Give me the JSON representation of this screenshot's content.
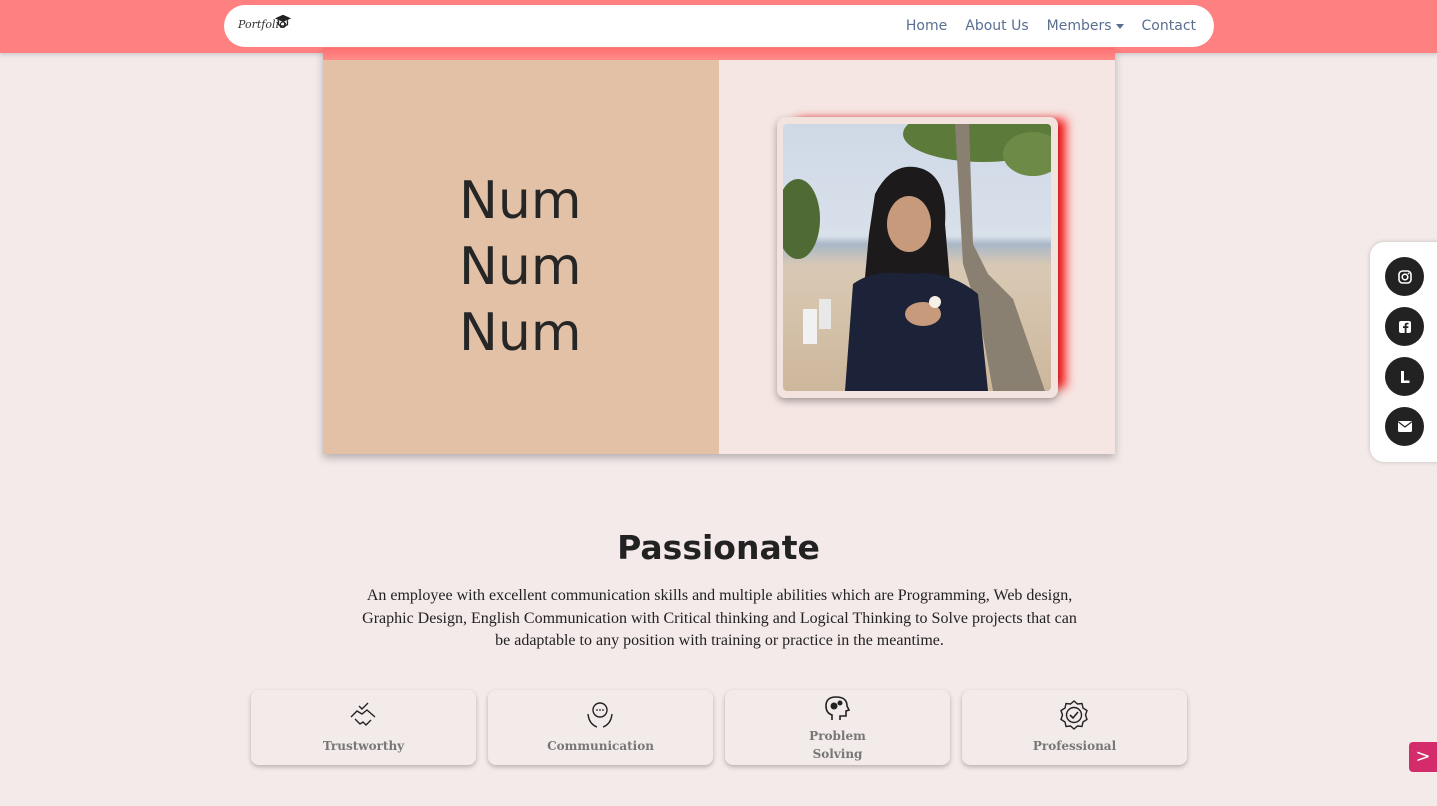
{
  "nav": {
    "logo_text": "Portfolio",
    "links": [
      "Home",
      "About Us",
      "Members",
      "Contact"
    ]
  },
  "hero": {
    "name_lines": [
      "Num",
      "Num",
      "Num"
    ]
  },
  "social": {
    "icons": [
      "instagram-icon",
      "facebook-icon",
      "line-icon",
      "mail-icon"
    ]
  },
  "section": {
    "title": "Passionate",
    "description": "An employee with excellent communication skills and multiple abilities which are Programming, Web design, Graphic Design, English Communication with Critical thinking and Logical Thinking to Solve projects that can be adaptable to any position with training or practice in the meantime."
  },
  "skills": [
    {
      "label": "Trustworthy",
      "icon": "handshake-icon"
    },
    {
      "label": "Communication",
      "icon": "speech-hands-icon"
    },
    {
      "label_line1": "Problem",
      "label_line2": "Solving",
      "icon": "head-gears-icon"
    },
    {
      "label": "Professional",
      "icon": "badge-check-icon"
    }
  ],
  "next_label": ">",
  "colors": {
    "topbar": "#ff8080",
    "nav_link": "#5a6e91",
    "hero_left": "#e2c1a7",
    "page_bg": "#f4eaea",
    "next_button": "#d42c6a"
  }
}
